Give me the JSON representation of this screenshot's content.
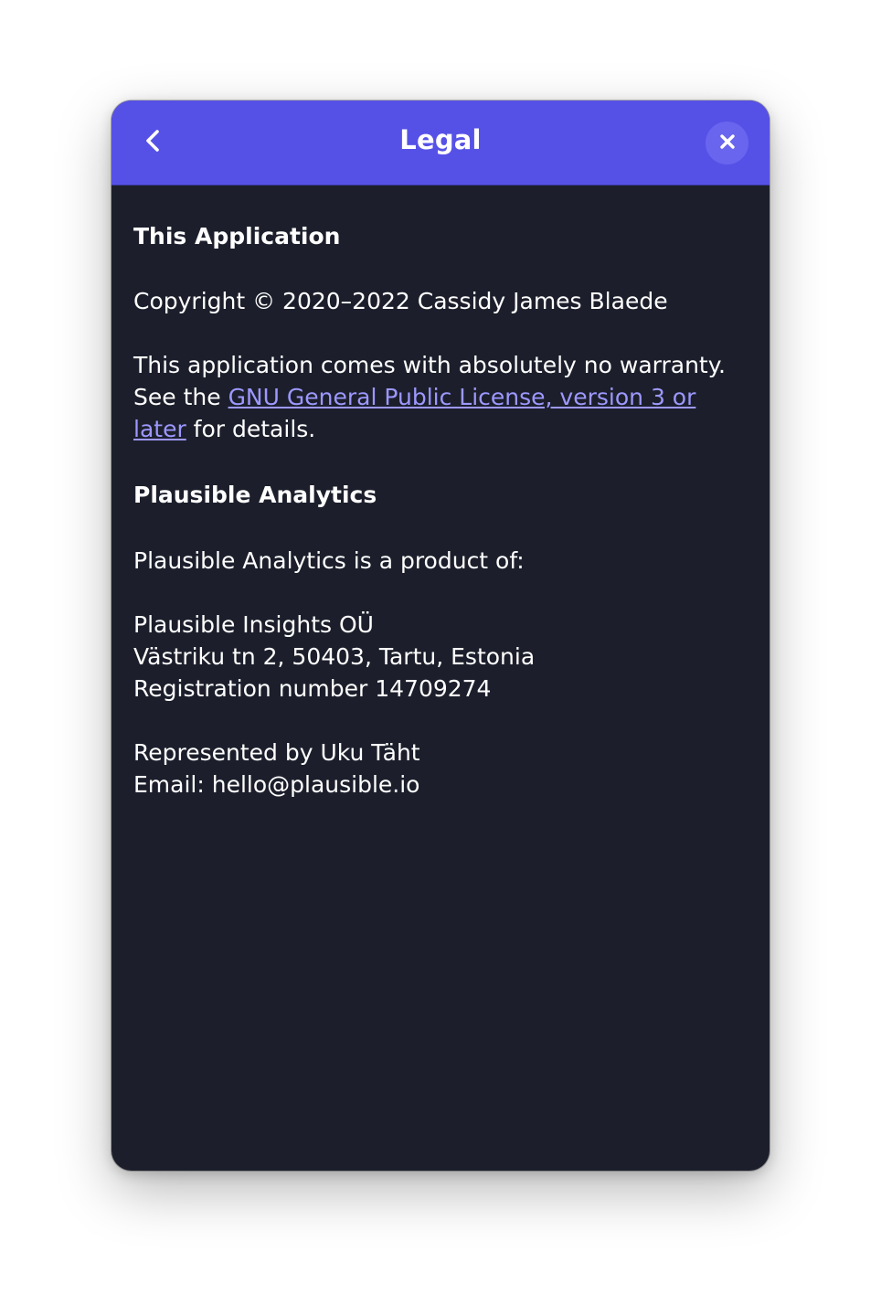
{
  "header": {
    "title": "Legal",
    "back_icon": "chevron-left-icon",
    "close_icon": "close-icon"
  },
  "sections": {
    "app": {
      "heading": "This Application",
      "copyright": "Copyright © 2020–2022 Cassidy James Blaede",
      "warranty_prefix": "This application comes with absolutely no warranty. See the ",
      "license_link": "GNU General Public License, version 3 or later",
      "warranty_suffix": " for details."
    },
    "plausible": {
      "heading": "Plausible Analytics",
      "intro": "Plausible Analytics is a product of:",
      "company": "Plausible Insights OÜ",
      "address": "Västriku tn 2, 50403, Tartu, Estonia",
      "registration": "Registration number 14709274",
      "represented": "Represented by Uku Täht",
      "email": "Email: hello@plausible.io"
    }
  },
  "colors": {
    "headerbar": "#5651e6",
    "background": "#1c1f2b",
    "link": "#9d98ff",
    "text": "#ffffff"
  }
}
